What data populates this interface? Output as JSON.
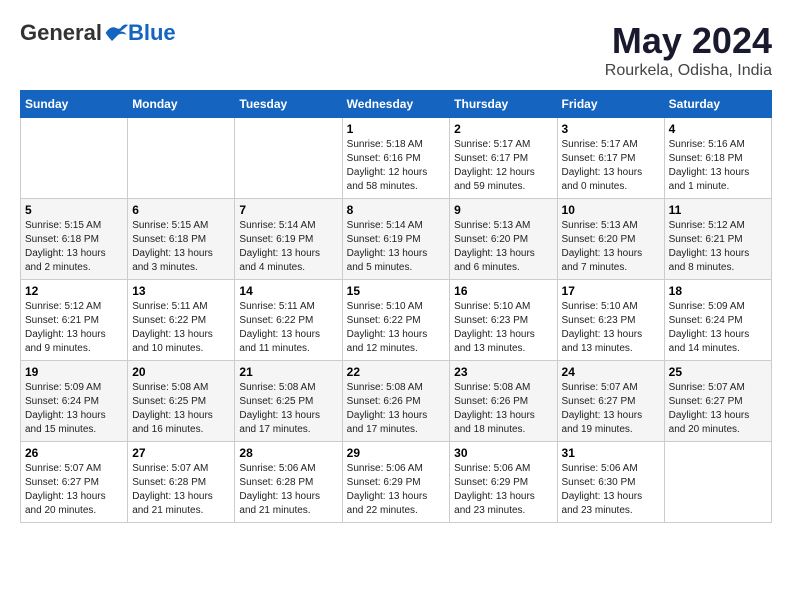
{
  "header": {
    "logo_general": "General",
    "logo_blue": "Blue",
    "month_title": "May 2024",
    "location": "Rourkela, Odisha, India"
  },
  "days_of_week": [
    "Sunday",
    "Monday",
    "Tuesday",
    "Wednesday",
    "Thursday",
    "Friday",
    "Saturday"
  ],
  "weeks": [
    [
      {
        "day": "",
        "info": ""
      },
      {
        "day": "",
        "info": ""
      },
      {
        "day": "",
        "info": ""
      },
      {
        "day": "1",
        "info": "Sunrise: 5:18 AM\nSunset: 6:16 PM\nDaylight: 12 hours and 58 minutes."
      },
      {
        "day": "2",
        "info": "Sunrise: 5:17 AM\nSunset: 6:17 PM\nDaylight: 12 hours and 59 minutes."
      },
      {
        "day": "3",
        "info": "Sunrise: 5:17 AM\nSunset: 6:17 PM\nDaylight: 13 hours and 0 minutes."
      },
      {
        "day": "4",
        "info": "Sunrise: 5:16 AM\nSunset: 6:18 PM\nDaylight: 13 hours and 1 minute."
      }
    ],
    [
      {
        "day": "5",
        "info": "Sunrise: 5:15 AM\nSunset: 6:18 PM\nDaylight: 13 hours and 2 minutes."
      },
      {
        "day": "6",
        "info": "Sunrise: 5:15 AM\nSunset: 6:18 PM\nDaylight: 13 hours and 3 minutes."
      },
      {
        "day": "7",
        "info": "Sunrise: 5:14 AM\nSunset: 6:19 PM\nDaylight: 13 hours and 4 minutes."
      },
      {
        "day": "8",
        "info": "Sunrise: 5:14 AM\nSunset: 6:19 PM\nDaylight: 13 hours and 5 minutes."
      },
      {
        "day": "9",
        "info": "Sunrise: 5:13 AM\nSunset: 6:20 PM\nDaylight: 13 hours and 6 minutes."
      },
      {
        "day": "10",
        "info": "Sunrise: 5:13 AM\nSunset: 6:20 PM\nDaylight: 13 hours and 7 minutes."
      },
      {
        "day": "11",
        "info": "Sunrise: 5:12 AM\nSunset: 6:21 PM\nDaylight: 13 hours and 8 minutes."
      }
    ],
    [
      {
        "day": "12",
        "info": "Sunrise: 5:12 AM\nSunset: 6:21 PM\nDaylight: 13 hours and 9 minutes."
      },
      {
        "day": "13",
        "info": "Sunrise: 5:11 AM\nSunset: 6:22 PM\nDaylight: 13 hours and 10 minutes."
      },
      {
        "day": "14",
        "info": "Sunrise: 5:11 AM\nSunset: 6:22 PM\nDaylight: 13 hours and 11 minutes."
      },
      {
        "day": "15",
        "info": "Sunrise: 5:10 AM\nSunset: 6:22 PM\nDaylight: 13 hours and 12 minutes."
      },
      {
        "day": "16",
        "info": "Sunrise: 5:10 AM\nSunset: 6:23 PM\nDaylight: 13 hours and 13 minutes."
      },
      {
        "day": "17",
        "info": "Sunrise: 5:10 AM\nSunset: 6:23 PM\nDaylight: 13 hours and 13 minutes."
      },
      {
        "day": "18",
        "info": "Sunrise: 5:09 AM\nSunset: 6:24 PM\nDaylight: 13 hours and 14 minutes."
      }
    ],
    [
      {
        "day": "19",
        "info": "Sunrise: 5:09 AM\nSunset: 6:24 PM\nDaylight: 13 hours and 15 minutes."
      },
      {
        "day": "20",
        "info": "Sunrise: 5:08 AM\nSunset: 6:25 PM\nDaylight: 13 hours and 16 minutes."
      },
      {
        "day": "21",
        "info": "Sunrise: 5:08 AM\nSunset: 6:25 PM\nDaylight: 13 hours and 17 minutes."
      },
      {
        "day": "22",
        "info": "Sunrise: 5:08 AM\nSunset: 6:26 PM\nDaylight: 13 hours and 17 minutes."
      },
      {
        "day": "23",
        "info": "Sunrise: 5:08 AM\nSunset: 6:26 PM\nDaylight: 13 hours and 18 minutes."
      },
      {
        "day": "24",
        "info": "Sunrise: 5:07 AM\nSunset: 6:27 PM\nDaylight: 13 hours and 19 minutes."
      },
      {
        "day": "25",
        "info": "Sunrise: 5:07 AM\nSunset: 6:27 PM\nDaylight: 13 hours and 20 minutes."
      }
    ],
    [
      {
        "day": "26",
        "info": "Sunrise: 5:07 AM\nSunset: 6:27 PM\nDaylight: 13 hours and 20 minutes."
      },
      {
        "day": "27",
        "info": "Sunrise: 5:07 AM\nSunset: 6:28 PM\nDaylight: 13 hours and 21 minutes."
      },
      {
        "day": "28",
        "info": "Sunrise: 5:06 AM\nSunset: 6:28 PM\nDaylight: 13 hours and 21 minutes."
      },
      {
        "day": "29",
        "info": "Sunrise: 5:06 AM\nSunset: 6:29 PM\nDaylight: 13 hours and 22 minutes."
      },
      {
        "day": "30",
        "info": "Sunrise: 5:06 AM\nSunset: 6:29 PM\nDaylight: 13 hours and 23 minutes."
      },
      {
        "day": "31",
        "info": "Sunrise: 5:06 AM\nSunset: 6:30 PM\nDaylight: 13 hours and 23 minutes."
      },
      {
        "day": "",
        "info": ""
      }
    ]
  ]
}
